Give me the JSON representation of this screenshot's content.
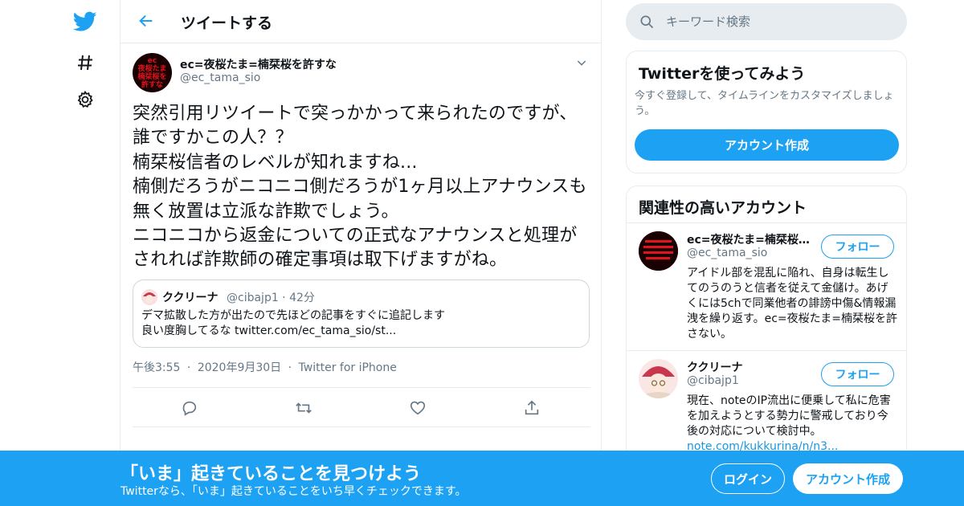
{
  "nav": {
    "logo_icon": "twitter-bird-icon",
    "explore_icon": "hashtag-icon",
    "settings_icon": "gear-icon"
  },
  "header": {
    "title": "ツイートする",
    "back_icon": "arrow-left-icon"
  },
  "tweet": {
    "avatar_text": "ec\n夜桜たま\n楠栞桜を\n許すな",
    "author_name": "ec=夜桜たま=楠栞桜を許すな",
    "author_handle": "@ec_tama_sio",
    "text": "突然引用リツイートで突っかかって来られたのですが、誰ですかこの人？？\n楠栞桜信者のレベルが知れますね...\n楠側だろうがニコニコ側だろうが1ヶ月以上アナウンスも無く放置は立派な詐欺でしょう。\nニコニコから返金についての正式なアナウンスと処理がされれば詐欺師の確定事項は取下げますがね。",
    "quote": {
      "name": "ククリーナ",
      "handle_time": "@cibajp1 · 42分",
      "text": "デマ拡散した方が出たので先ほどの記事をすぐに追記します\n良い度胸してるな twitter.com/ec_tama_sio/st..."
    },
    "time": "午後3:55",
    "date": "2020年9月30日",
    "source": "Twitter for iPhone",
    "actions": [
      "reply-icon",
      "retweet-icon",
      "like-icon",
      "share-icon"
    ]
  },
  "search": {
    "placeholder": "キーワード検索"
  },
  "signup_card": {
    "title": "Twitterを使ってみよう",
    "description": "今すぐ登録して、タイムラインをカスタマイズしましょう。",
    "button": "アカウント作成"
  },
  "related": {
    "title": "関連性の高いアカウント",
    "accounts": [
      {
        "name": "ec=夜桜たま=楠栞桜を許すな",
        "handle": "@ec_tama_sio",
        "follow": "フォロー",
        "bio": "アイドル部を混乱に陥れ、自身は転生してのうのうと信者を従えて金儲け。あげくには5chで同業他者の誹謗中傷&情報漏洩を繰り返す。ec=夜桜たま=楠栞桜を許さない。"
      },
      {
        "name": "ククリーナ",
        "handle": "@cibajp1",
        "follow": "フォロー",
        "bio": "現在、noteのIP流出に便乗して私に危害を加えようとする勢力に警戒しており今後の対応について検討中。",
        "link": "note.com/kukkurina/n/n3..."
      }
    ]
  },
  "banner": {
    "title": "「いま」起きていることを見つけよう",
    "subtitle": "Twitterなら、「いま」起きていることをいち早くチェックできます。",
    "login": "ログイン",
    "signup": "アカウント作成"
  },
  "colors": {
    "accent": "#1da1f2",
    "secondary_text": "#657786",
    "border": "#e6ecf0"
  }
}
